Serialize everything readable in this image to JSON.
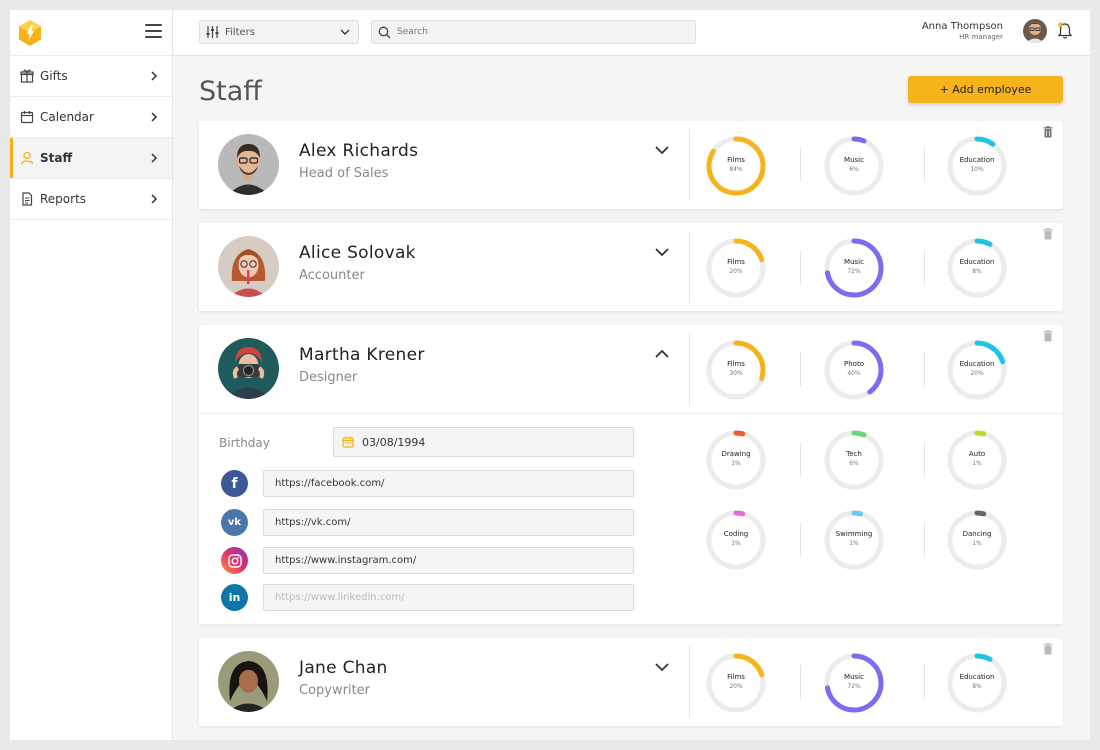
{
  "nav": {
    "items": [
      {
        "label": "Gifts",
        "icon": "gift-icon",
        "active": false
      },
      {
        "label": "Calendar",
        "icon": "calendar-icon",
        "active": false
      },
      {
        "label": "Staff",
        "icon": "user-icon",
        "active": true
      },
      {
        "label": "Reports",
        "icon": "document-icon",
        "active": false
      }
    ]
  },
  "topbar": {
    "filters_label": "Filters",
    "search_placeholder": "Search",
    "user_name": "Anna Thompson",
    "user_role": "HR manager"
  },
  "page": {
    "title": "Staff",
    "add_button": "+ Add employee"
  },
  "colors": {
    "accent": "#f7b31c",
    "films": "#f7b31c",
    "music": "#7b6cf0",
    "photo": "#7b6cf0",
    "education": "#1ec4e0",
    "ring_track": "#ececec"
  },
  "employees": [
    {
      "name": "Alex Richards",
      "role": "Head of Sales",
      "expanded": false,
      "interests": [
        {
          "label": "Films",
          "pct": "84%",
          "value": 84,
          "color": "#f7b31c"
        },
        {
          "label": "Music",
          "pct": "6%",
          "value": 6,
          "color": "#7b6cf0"
        },
        {
          "label": "Education",
          "pct": "10%",
          "value": 10,
          "color": "#1ec4e0"
        }
      ]
    },
    {
      "name": "Alice Solovak",
      "role": "Accounter",
      "expanded": false,
      "interests": [
        {
          "label": "Films",
          "pct": "20%",
          "value": 20,
          "color": "#f7b31c"
        },
        {
          "label": "Music",
          "pct": "72%",
          "value": 72,
          "color": "#7b6cf0"
        },
        {
          "label": "Education",
          "pct": "8%",
          "value": 8,
          "color": "#1ec4e0"
        }
      ]
    },
    {
      "name": "Martha Krener",
      "role": "Designer",
      "expanded": true,
      "interests": [
        {
          "label": "Films",
          "pct": "30%",
          "value": 30,
          "color": "#f7b31c"
        },
        {
          "label": "Photo",
          "pct": "40%",
          "value": 40,
          "color": "#7b6cf0"
        },
        {
          "label": "Education",
          "pct": "20%",
          "value": 20,
          "color": "#1ec4e0"
        }
      ],
      "details": {
        "birthday_label": "Birthday",
        "birthday": "03/08/1994",
        "facebook": "https://facebook.com/",
        "vk": "https://vk.com/",
        "instagram": "https://www.instagram.com/",
        "linkedin_placeholder": "https://www.linkedin.com/"
      },
      "extra_interests": [
        {
          "label": "Drawing",
          "pct": "1%",
          "value": 1,
          "color": "#f05a28"
        },
        {
          "label": "Tech",
          "pct": "6%",
          "value": 6,
          "color": "#66d97b"
        },
        {
          "label": "Auto",
          "pct": "1%",
          "value": 1,
          "color": "#b8e020"
        },
        {
          "label": "Coding",
          "pct": "1%",
          "value": 1,
          "color": "#e56ad8"
        },
        {
          "label": "Swimming",
          "pct": "1%",
          "value": 1,
          "color": "#6ec8ec"
        },
        {
          "label": "Dancing",
          "pct": "1%",
          "value": 1,
          "color": "#666666"
        }
      ]
    },
    {
      "name": "Jane Chan",
      "role": "Copywriter",
      "expanded": false,
      "interests": [
        {
          "label": "Films",
          "pct": "20%",
          "value": 20,
          "color": "#f7b31c"
        },
        {
          "label": "Music",
          "pct": "72%",
          "value": 72,
          "color": "#7b6cf0"
        },
        {
          "label": "Education",
          "pct": "8%",
          "value": 8,
          "color": "#1ec4e0"
        }
      ]
    }
  ]
}
